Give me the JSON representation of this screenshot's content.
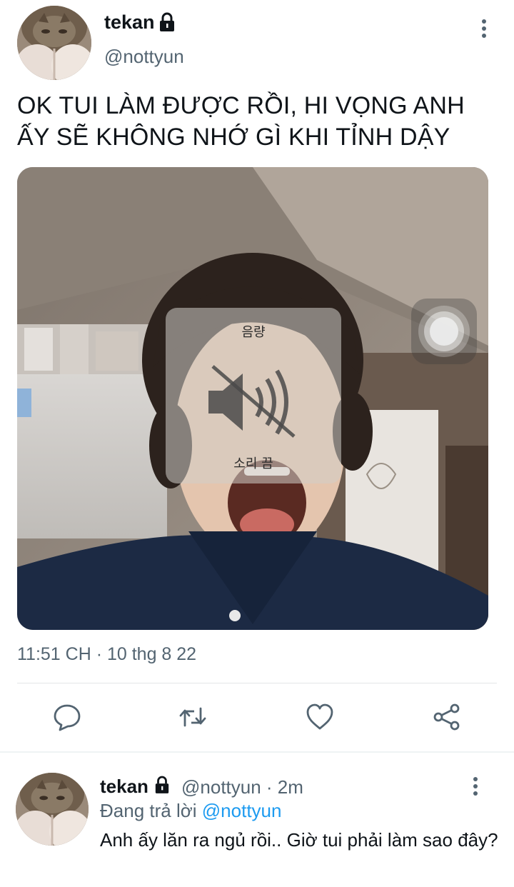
{
  "tweet": {
    "author": {
      "display_name": "tekan",
      "handle": "@nottyun",
      "protected_icon": "lock-icon"
    },
    "text": "OK TUI LÀM ĐƯỢC RỒI, HI VỌNG ANH ẤY SẼ KHÔNG NHỚ GÌ KHI TỈNH DẬY",
    "media": {
      "overlay_title": "음량",
      "overlay_status": "소리 끔",
      "overlay_icon": "volume-muted-icon"
    },
    "timestamp": "11:51 CH · 10 thg 8 22",
    "actions": [
      "reply-icon",
      "retweet-icon",
      "like-icon",
      "share-icon"
    ]
  },
  "reply": {
    "display_name": "tekan",
    "handle_time": "@nottyun · 2m",
    "replying_prefix": "Đang trả lời ",
    "replying_mention": "@nottyun",
    "text": "Anh ấy lăn ra ngủ rồi.. Giờ tui phải làm sao đây?"
  },
  "colors": {
    "text_primary": "#0f1419",
    "text_secondary": "#536471",
    "accent": "#1d9bf0",
    "divider": "#e3e6e8"
  }
}
